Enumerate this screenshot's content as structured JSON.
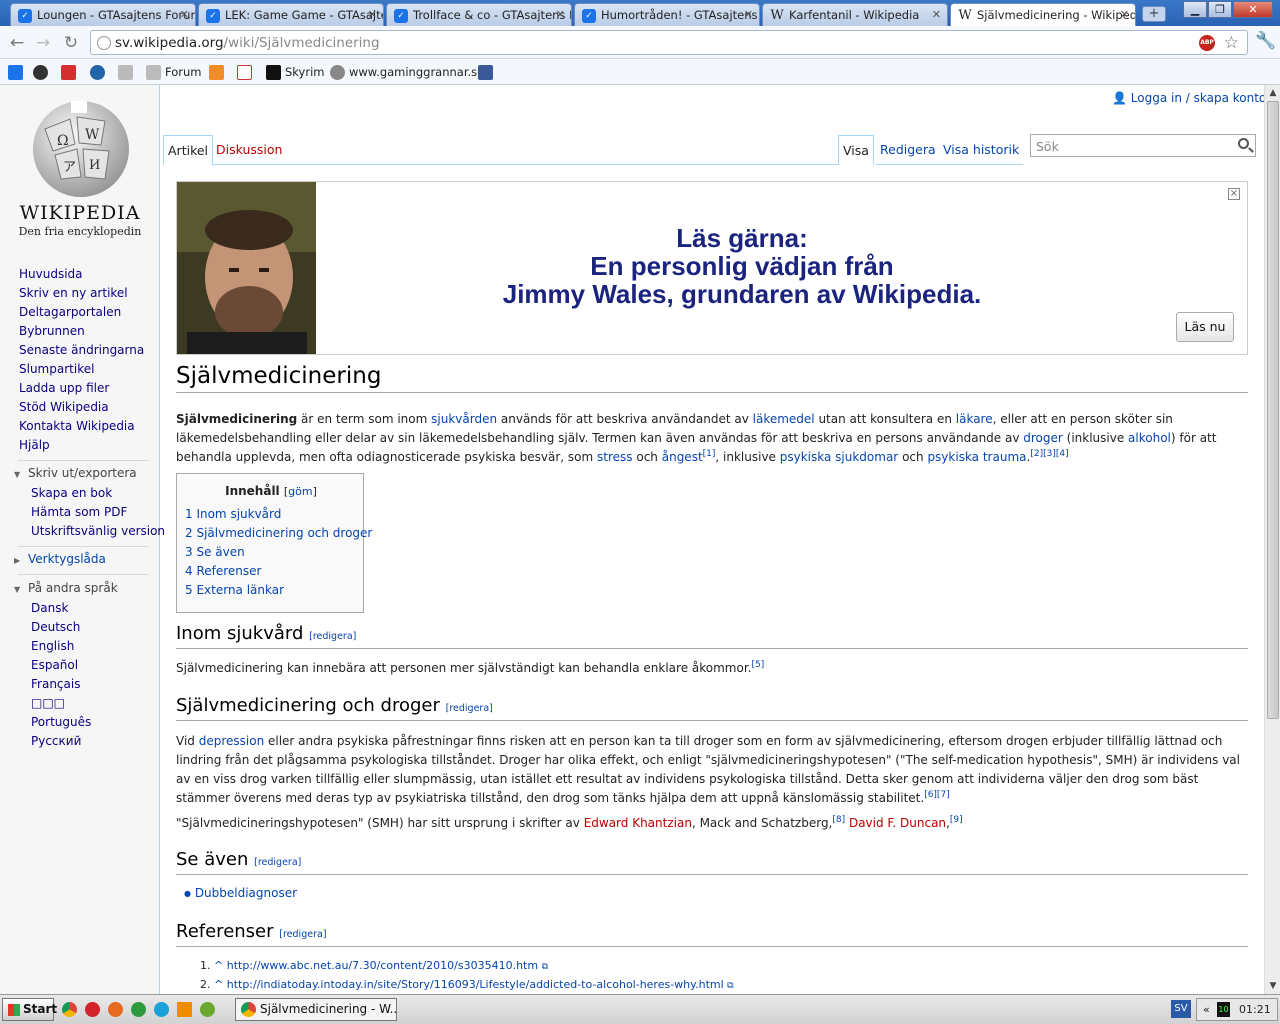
{
  "browser": {
    "tabs": [
      {
        "label": "Loungen - GTAsajtens Forum",
        "active": false
      },
      {
        "label": "LEK: Game Game - GTAsajter",
        "active": false
      },
      {
        "label": "Trollface & co - GTAsajtens F",
        "active": false
      },
      {
        "label": "Humortråden! - GTAsajtens F",
        "active": false
      },
      {
        "label": "Karfentanil - Wikipedia",
        "active": false
      },
      {
        "label": "Självmedicinering - Wikipedia",
        "active": true
      }
    ],
    "url_host": "sv.wikipedia.org",
    "url_path": "/wiki/Självmedicinering",
    "bookmarks": [
      "Forum",
      "Skyrim",
      "www.gaminggrannar.se"
    ],
    "abp_label": "ABP"
  },
  "wiki": {
    "wordmark": "WIKIPEDIA",
    "tagline": "Den fria encyklopedin",
    "userlinks": "Logga in / skapa konto",
    "nav": [
      "Huvudsida",
      "Skriv en ny artikel",
      "Deltagarportalen",
      "Bybrunnen",
      "Senaste ändringarna",
      "Slumpartikel",
      "Ladda upp filer",
      "Stöd Wikipedia",
      "Kontakta Wikipedia",
      "Hjälp"
    ],
    "print_heading": "Skriv ut/exportera",
    "print_items": [
      "Skapa en bok",
      "Hämta som PDF",
      "Utskriftsvänlig version"
    ],
    "tools_heading": "Verktygslåda",
    "lang_heading": "På andra språk",
    "languages": [
      "Dansk",
      "Deutsch",
      "English",
      "Español",
      "Français",
      "□□□",
      "Português",
      "Русский"
    ],
    "tabs": {
      "article": "Artikel",
      "talk": "Diskussion",
      "view": "Visa",
      "edit": "Redigera",
      "history": "Visa historik"
    },
    "search_placeholder": "Sök"
  },
  "banner": {
    "line1": "Läs gärna:",
    "line2": "En personlig vädjan från",
    "line3": "Jimmy Wales, grundaren av Wikipedia.",
    "button": "Läs nu",
    "close": "×"
  },
  "article": {
    "title": "Självmedicinering",
    "lead": {
      "bold": "Självmedicinering",
      "t1": " är en term som inom ",
      "l1": "sjukvården",
      "t2": " används för att beskriva användandet av ",
      "l2": "läkemedel",
      "t3": " utan att konsultera en ",
      "l3": "läkare",
      "t4": ", eller att en person sköter sin läkemedelsbehandling eller delar av sin läkemedelsbehandling själv. Termen kan även användas för att beskriva en persons användande av ",
      "l4": "droger",
      "t5": " (inklusive ",
      "l5": "alkohol",
      "t6": ") för att behandla upplevda, men ofta odiagnosticerade psykiska besvär, som ",
      "l6": "stress",
      "t7": " och ",
      "l7": "ångest",
      "s1": "[1]",
      "t8": ", inklusive ",
      "l8": "psykiska sjukdomar",
      "t9": " och ",
      "l9": "psykiska trauma",
      "t10": ".",
      "s2": "[2][3][4]"
    },
    "toc": {
      "title": "Innehåll",
      "hide": "göm",
      "items": [
        "1 Inom sjukvård",
        "2 Självmedicinering och droger",
        "3 Se även",
        "4 Referenser",
        "5 Externa länkar"
      ]
    },
    "edit_label": "redigera",
    "s1": {
      "title": "Inom sjukvård",
      "text": "Självmedicinering kan innebära att personen mer självständigt kan behandla enklare åkommor.",
      "sup": "[5]"
    },
    "s2": {
      "title": "Självmedicinering och droger",
      "p1a": "Vid ",
      "p1l": "depression",
      "p1b": " eller andra psykiska påfrestningar finns risken att en person kan ta till droger som en form av självmedicinering, eftersom drogen erbjuder tillfällig lättnad och lindring från det plågsamma psykologiska tillståndet. Droger har olika effekt, och enligt \"självmedicineringshypotesen\" (\"The self-medication hypothesis\", SMH) är individens val av en viss drog varken tillfällig eller slumpmässig, utan istället ett resultat av individens psykologiska tillstånd. Detta sker genom att individerna väljer den drog som bäst stämmer överens med deras typ av psykiatriska tillstånd, den drog som tänks hjälpa dem att uppnå känslomässig stabilitet.",
      "p1s": "[6][7]",
      "p2a": "\"Självmedicineringshypotesen\" (SMH) har sitt ursprung i skrifter av ",
      "p2l1": "Edward Khantzian",
      "p2b": ", Mack and Schatzberg,",
      "p2s1": "[8]",
      "p2l2": "David F. Duncan",
      "p2c": ",",
      "p2s2": "[9]"
    },
    "s3": {
      "title": "Se även",
      "items": [
        "Dubbeldiagnoser"
      ]
    },
    "s4": {
      "title": "Referenser",
      "refs": [
        {
          "n": "1.",
          "caret": "^",
          "url": "http://www.abc.net.au/7.30/content/2010/s3035410.htm"
        },
        {
          "n": "2.",
          "caret": "^",
          "url": "http://indiatoday.intoday.in/site/Story/116093/Lifestyle/addicted-to-alcohol-heres-why.html"
        }
      ]
    }
  },
  "taskbar": {
    "start": "Start",
    "item": "Självmedicinering - W...",
    "lang": "SV",
    "clock": "01:21"
  }
}
